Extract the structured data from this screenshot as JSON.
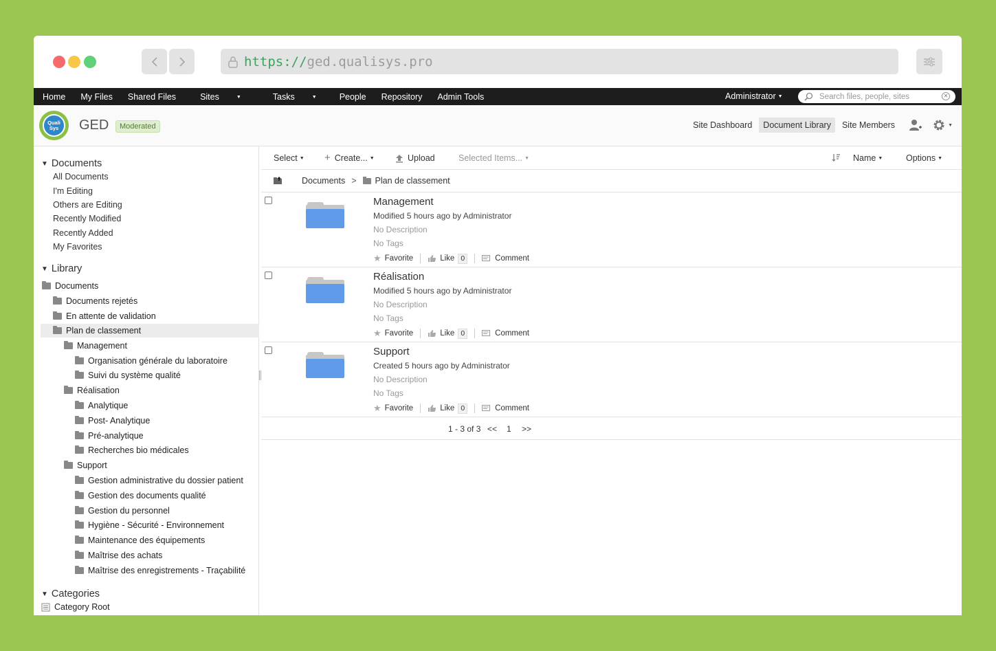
{
  "browser": {
    "url_scheme": "https://",
    "url_host": "ged.qualisys.pro"
  },
  "topbar": {
    "nav": [
      "Home",
      "My Files",
      "Shared Files",
      "Sites",
      "Tasks",
      "People",
      "Repository",
      "Admin Tools"
    ],
    "user": "Administrator",
    "search_placeholder": "Search files, people, sites"
  },
  "site": {
    "logo_text_1": "Quali",
    "logo_text_2": "Sys",
    "title": "GED",
    "badge": "Moderated",
    "nav": {
      "dashboard": "Site Dashboard",
      "library": "Document Library",
      "members": "Site Members"
    }
  },
  "sidebar": {
    "documents_heading": "Documents",
    "filters": [
      "All Documents",
      "I'm Editing",
      "Others are Editing",
      "Recently Modified",
      "Recently Added",
      "My Favorites"
    ],
    "library_heading": "Library",
    "tree": [
      {
        "label": "Documents",
        "level": 0
      },
      {
        "label": "Documents rejetés",
        "level": 1
      },
      {
        "label": "En attente de validation",
        "level": 1
      },
      {
        "label": "Plan de classement",
        "level": 1
      },
      {
        "label": "Management",
        "level": 2
      },
      {
        "label": "Organisation générale du laboratoire",
        "level": 3
      },
      {
        "label": "Suivi du système qualité",
        "level": 3
      },
      {
        "label": "Réalisation",
        "level": 2
      },
      {
        "label": "Analytique",
        "level": 3
      },
      {
        "label": "Post- Analytique",
        "level": 3
      },
      {
        "label": "Pré-analytique",
        "level": 3
      },
      {
        "label": "Recherches bio médicales",
        "level": 3
      },
      {
        "label": "Support",
        "level": 2
      },
      {
        "label": "Gestion administrative du dossier patient",
        "level": 3
      },
      {
        "label": "Gestion des documents qualité",
        "level": 3
      },
      {
        "label": "Gestion du personnel",
        "level": 3
      },
      {
        "label": "Hygiène - Sécurité - Environnement",
        "level": 3
      },
      {
        "label": "Maintenance des équipements",
        "level": 3
      },
      {
        "label": "Maîtrise des achats",
        "level": 3
      },
      {
        "label": "Maîtrise des enregistrements - Traçabilité",
        "level": 3
      }
    ],
    "categories_heading": "Categories",
    "category_root": "Category Root"
  },
  "toolbar": {
    "select": "Select",
    "create": "Create...",
    "upload": "Upload",
    "selected_items": "Selected Items...",
    "sort": "Name",
    "options": "Options"
  },
  "path": {
    "root": "Documents",
    "separator": ">",
    "current": "Plan de classement"
  },
  "items": [
    {
      "name": "Management",
      "meta": "Modified 5 hours ago by Administrator",
      "description": "No Description",
      "tags": "No Tags",
      "favorite": "Favorite",
      "like": "Like",
      "like_count": "0",
      "comment": "Comment"
    },
    {
      "name": "Réalisation",
      "meta": "Modified 5 hours ago by Administrator",
      "description": "No Description",
      "tags": "No Tags",
      "favorite": "Favorite",
      "like": "Like",
      "like_count": "0",
      "comment": "Comment"
    },
    {
      "name": "Support",
      "meta": "Created 5 hours ago by Administrator",
      "description": "No Description",
      "tags": "No Tags",
      "favorite": "Favorite",
      "like": "Like",
      "like_count": "0",
      "comment": "Comment"
    }
  ],
  "pager": {
    "range": "1 - 3 of 3",
    "prev": "<<",
    "page": "1",
    "next": ">>"
  }
}
